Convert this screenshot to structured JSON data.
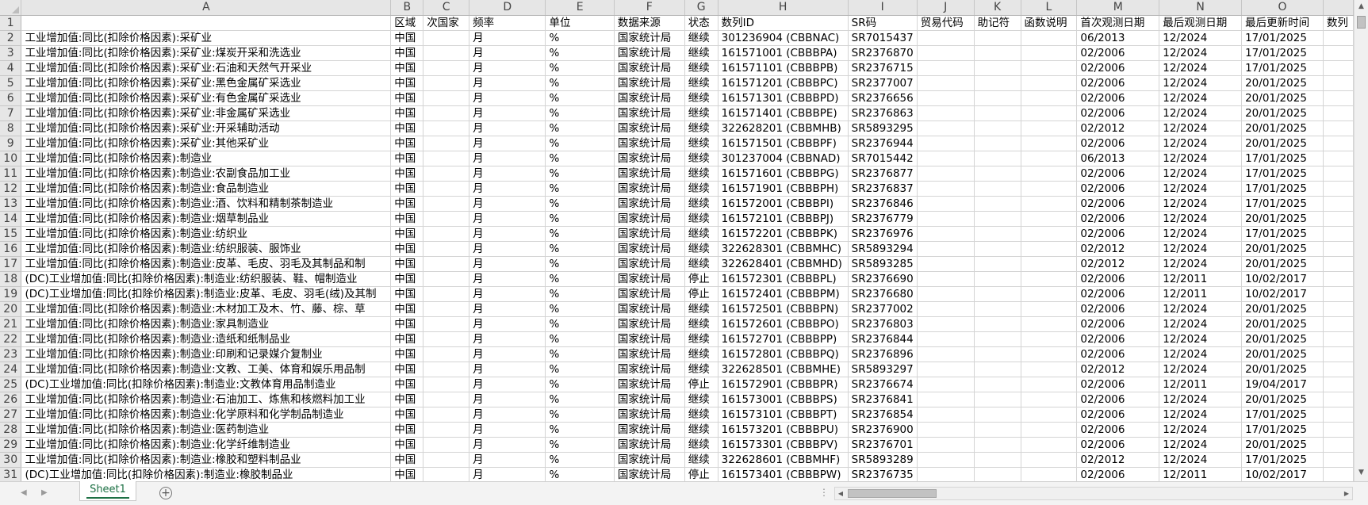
{
  "sheet": {
    "column_letters": [
      "A",
      "B",
      "C",
      "D",
      "E",
      "F",
      "G",
      "H",
      "I",
      "J",
      "K",
      "L",
      "M",
      "N",
      "O",
      ""
    ],
    "header_row": {
      "number": "1",
      "cells": [
        "",
        "区域",
        "次国家",
        "频率",
        "单位",
        "数据来源",
        "状态",
        "数列ID",
        "SR码",
        "贸易代码",
        "助记符",
        "函数说明",
        "首次观测日期",
        "最后观测日期",
        "最后更新时间",
        "数列"
      ]
    },
    "rows": [
      {
        "n": "2",
        "a": "工业增加值:同比(扣除价格因素):采矿业",
        "b": "中国",
        "c": "",
        "d": "月",
        "e": "%",
        "f": "国家统计局",
        "g": "继续",
        "h": "301236904 (CBBNAC)",
        "i": "SR7015437",
        "m": "06/2013",
        "nn": "12/2024",
        "o": "17/01/2025"
      },
      {
        "n": "3",
        "a": "工业增加值:同比(扣除价格因素):采矿业:煤炭开采和洗选业",
        "b": "中国",
        "c": "",
        "d": "月",
        "e": "%",
        "f": "国家统计局",
        "g": "继续",
        "h": "161571001 (CBBBPA)",
        "i": "SR2376870",
        "m": "02/2006",
        "nn": "12/2024",
        "o": "17/01/2025"
      },
      {
        "n": "4",
        "a": "工业增加值:同比(扣除价格因素):采矿业:石油和天然气开采业",
        "b": "中国",
        "c": "",
        "d": "月",
        "e": "%",
        "f": "国家统计局",
        "g": "继续",
        "h": "161571101 (CBBBPB)",
        "i": "SR2376715",
        "m": "02/2006",
        "nn": "12/2024",
        "o": "17/01/2025"
      },
      {
        "n": "5",
        "a": "工业增加值:同比(扣除价格因素):采矿业:黑色金属矿采选业",
        "b": "中国",
        "c": "",
        "d": "月",
        "e": "%",
        "f": "国家统计局",
        "g": "继续",
        "h": "161571201 (CBBBPC)",
        "i": "SR2377007",
        "m": "02/2006",
        "nn": "12/2024",
        "o": "20/01/2025"
      },
      {
        "n": "6",
        "a": "工业增加值:同比(扣除价格因素):采矿业:有色金属矿采选业",
        "b": "中国",
        "c": "",
        "d": "月",
        "e": "%",
        "f": "国家统计局",
        "g": "继续",
        "h": "161571301 (CBBBPD)",
        "i": "SR2376656",
        "m": "02/2006",
        "nn": "12/2024",
        "o": "20/01/2025"
      },
      {
        "n": "7",
        "a": "工业增加值:同比(扣除价格因素):采矿业:非金属矿采选业",
        "b": "中国",
        "c": "",
        "d": "月",
        "e": "%",
        "f": "国家统计局",
        "g": "继续",
        "h": "161571401 (CBBBPE)",
        "i": "SR2376863",
        "m": "02/2006",
        "nn": "12/2024",
        "o": "20/01/2025"
      },
      {
        "n": "8",
        "a": "工业增加值:同比(扣除价格因素):采矿业:开采辅助活动",
        "b": "中国",
        "c": "",
        "d": "月",
        "e": "%",
        "f": "国家统计局",
        "g": "继续",
        "h": "322628201 (CBBMHB)",
        "i": "SR5893295",
        "m": "02/2012",
        "nn": "12/2024",
        "o": "20/01/2025"
      },
      {
        "n": "9",
        "a": "工业增加值:同比(扣除价格因素):采矿业:其他采矿业",
        "b": "中国",
        "c": "",
        "d": "月",
        "e": "%",
        "f": "国家统计局",
        "g": "继续",
        "h": "161571501 (CBBBPF)",
        "i": "SR2376944",
        "m": "02/2006",
        "nn": "12/2024",
        "o": "20/01/2025"
      },
      {
        "n": "10",
        "a": "工业增加值:同比(扣除价格因素):制造业",
        "b": "中国",
        "c": "",
        "d": "月",
        "e": "%",
        "f": "国家统计局",
        "g": "继续",
        "h": "301237004 (CBBNAD)",
        "i": "SR7015442",
        "m": "06/2013",
        "nn": "12/2024",
        "o": "17/01/2025"
      },
      {
        "n": "11",
        "a": "工业增加值:同比(扣除价格因素):制造业:农副食品加工业",
        "b": "中国",
        "c": "",
        "d": "月",
        "e": "%",
        "f": "国家统计局",
        "g": "继续",
        "h": "161571601 (CBBBPG)",
        "i": "SR2376877",
        "m": "02/2006",
        "nn": "12/2024",
        "o": "17/01/2025"
      },
      {
        "n": "12",
        "a": "工业增加值:同比(扣除价格因素):制造业:食品制造业",
        "b": "中国",
        "c": "",
        "d": "月",
        "e": "%",
        "f": "国家统计局",
        "g": "继续",
        "h": "161571901 (CBBBPH)",
        "i": "SR2376837",
        "m": "02/2006",
        "nn": "12/2024",
        "o": "17/01/2025"
      },
      {
        "n": "13",
        "a": "工业增加值:同比(扣除价格因素):制造业:酒、饮料和精制茶制造业",
        "b": "中国",
        "c": "",
        "d": "月",
        "e": "%",
        "f": "国家统计局",
        "g": "继续",
        "h": "161572001 (CBBBPI)",
        "i": "SR2376846",
        "m": "02/2006",
        "nn": "12/2024",
        "o": "17/01/2025"
      },
      {
        "n": "14",
        "a": "工业增加值:同比(扣除价格因素):制造业:烟草制品业",
        "b": "中国",
        "c": "",
        "d": "月",
        "e": "%",
        "f": "国家统计局",
        "g": "继续",
        "h": "161572101 (CBBBPJ)",
        "i": "SR2376779",
        "m": "02/2006",
        "nn": "12/2024",
        "o": "20/01/2025"
      },
      {
        "n": "15",
        "a": "工业增加值:同比(扣除价格因素):制造业:纺织业",
        "b": "中国",
        "c": "",
        "d": "月",
        "e": "%",
        "f": "国家统计局",
        "g": "继续",
        "h": "161572201 (CBBBPK)",
        "i": "SR2376976",
        "m": "02/2006",
        "nn": "12/2024",
        "o": "17/01/2025"
      },
      {
        "n": "16",
        "a": "工业增加值:同比(扣除价格因素):制造业:纺织服装、服饰业",
        "b": "中国",
        "c": "",
        "d": "月",
        "e": "%",
        "f": "国家统计局",
        "g": "继续",
        "h": "322628301 (CBBMHC)",
        "i": "SR5893294",
        "m": "02/2012",
        "nn": "12/2024",
        "o": "20/01/2025"
      },
      {
        "n": "17",
        "a": "工业增加值:同比(扣除价格因素):制造业:皮革、毛皮、羽毛及其制品和制",
        "b": "中国",
        "c": "",
        "d": "月",
        "e": "%",
        "f": "国家统计局",
        "g": "继续",
        "h": "322628401 (CBBMHD)",
        "i": "SR5893285",
        "m": "02/2012",
        "nn": "12/2024",
        "o": "20/01/2025"
      },
      {
        "n": "18",
        "a": "(DC)工业增加值:同比(扣除价格因素):制造业:纺织服装、鞋、帽制造业",
        "b": "中国",
        "c": "",
        "d": "月",
        "e": "%",
        "f": "国家统计局",
        "g": "停止",
        "h": "161572301 (CBBBPL)",
        "i": "SR2376690",
        "m": "02/2006",
        "nn": "12/2011",
        "o": "10/02/2017"
      },
      {
        "n": "19",
        "a": "(DC)工业增加值:同比(扣除价格因素):制造业:皮革、毛皮、羽毛(绒)及其制",
        "b": "中国",
        "c": "",
        "d": "月",
        "e": "%",
        "f": "国家统计局",
        "g": "停止",
        "h": "161572401 (CBBBPM)",
        "i": "SR2376680",
        "m": "02/2006",
        "nn": "12/2011",
        "o": "10/02/2017"
      },
      {
        "n": "20",
        "a": "工业增加值:同比(扣除价格因素):制造业:木材加工及木、竹、藤、棕、草",
        "b": "中国",
        "c": "",
        "d": "月",
        "e": "%",
        "f": "国家统计局",
        "g": "继续",
        "h": "161572501 (CBBBPN)",
        "i": "SR2377002",
        "m": "02/2006",
        "nn": "12/2024",
        "o": "20/01/2025"
      },
      {
        "n": "21",
        "a": "工业增加值:同比(扣除价格因素):制造业:家具制造业",
        "b": "中国",
        "c": "",
        "d": "月",
        "e": "%",
        "f": "国家统计局",
        "g": "继续",
        "h": "161572601 (CBBBPO)",
        "i": "SR2376803",
        "m": "02/2006",
        "nn": "12/2024",
        "o": "20/01/2025"
      },
      {
        "n": "22",
        "a": "工业增加值:同比(扣除价格因素):制造业:造纸和纸制品业",
        "b": "中国",
        "c": "",
        "d": "月",
        "e": "%",
        "f": "国家统计局",
        "g": "继续",
        "h": "161572701 (CBBBPP)",
        "i": "SR2376844",
        "m": "02/2006",
        "nn": "12/2024",
        "o": "20/01/2025"
      },
      {
        "n": "23",
        "a": "工业增加值:同比(扣除价格因素):制造业:印刷和记录媒介复制业",
        "b": "中国",
        "c": "",
        "d": "月",
        "e": "%",
        "f": "国家统计局",
        "g": "继续",
        "h": "161572801 (CBBBPQ)",
        "i": "SR2376896",
        "m": "02/2006",
        "nn": "12/2024",
        "o": "20/01/2025"
      },
      {
        "n": "24",
        "a": "工业增加值:同比(扣除价格因素):制造业:文教、工美、体育和娱乐用品制",
        "b": "中国",
        "c": "",
        "d": "月",
        "e": "%",
        "f": "国家统计局",
        "g": "继续",
        "h": "322628501 (CBBMHE)",
        "i": "SR5893297",
        "m": "02/2012",
        "nn": "12/2024",
        "o": "20/01/2025"
      },
      {
        "n": "25",
        "a": "(DC)工业增加值:同比(扣除价格因素):制造业:文教体育用品制造业",
        "b": "中国",
        "c": "",
        "d": "月",
        "e": "%",
        "f": "国家统计局",
        "g": "停止",
        "h": "161572901 (CBBBPR)",
        "i": "SR2376674",
        "m": "02/2006",
        "nn": "12/2011",
        "o": "19/04/2017"
      },
      {
        "n": "26",
        "a": "工业增加值:同比(扣除价格因素):制造业:石油加工、炼焦和核燃料加工业",
        "b": "中国",
        "c": "",
        "d": "月",
        "e": "%",
        "f": "国家统计局",
        "g": "继续",
        "h": "161573001 (CBBBPS)",
        "i": "SR2376841",
        "m": "02/2006",
        "nn": "12/2024",
        "o": "20/01/2025"
      },
      {
        "n": "27",
        "a": "工业增加值:同比(扣除价格因素):制造业:化学原料和化学制品制造业",
        "b": "中国",
        "c": "",
        "d": "月",
        "e": "%",
        "f": "国家统计局",
        "g": "继续",
        "h": "161573101 (CBBBPT)",
        "i": "SR2376854",
        "m": "02/2006",
        "nn": "12/2024",
        "o": "17/01/2025"
      },
      {
        "n": "28",
        "a": "工业增加值:同比(扣除价格因素):制造业:医药制造业",
        "b": "中国",
        "c": "",
        "d": "月",
        "e": "%",
        "f": "国家统计局",
        "g": "继续",
        "h": "161573201 (CBBBPU)",
        "i": "SR2376900",
        "m": "02/2006",
        "nn": "12/2024",
        "o": "17/01/2025"
      },
      {
        "n": "29",
        "a": "工业增加值:同比(扣除价格因素):制造业:化学纤维制造业",
        "b": "中国",
        "c": "",
        "d": "月",
        "e": "%",
        "f": "国家统计局",
        "g": "继续",
        "h": "161573301 (CBBBPV)",
        "i": "SR2376701",
        "m": "02/2006",
        "nn": "12/2024",
        "o": "20/01/2025"
      },
      {
        "n": "30",
        "a": "工业增加值:同比(扣除价格因素):制造业:橡胶和塑料制品业",
        "b": "中国",
        "c": "",
        "d": "月",
        "e": "%",
        "f": "国家统计局",
        "g": "继续",
        "h": "322628601 (CBBMHF)",
        "i": "SR5893289",
        "m": "02/2012",
        "nn": "12/2024",
        "o": "17/01/2025"
      },
      {
        "n": "31",
        "a": "(DC)工业增加值:同比(扣除价格因素):制造业:橡胶制品业",
        "b": "中国",
        "c": "",
        "d": "月",
        "e": "%",
        "f": "国家统计局",
        "g": "停止",
        "h": "161573401 (CBBBPW)",
        "i": "SR2376735",
        "m": "02/2006",
        "nn": "12/2011",
        "o": "10/02/2017"
      }
    ]
  },
  "tabs": {
    "active_sheet": "Sheet1"
  },
  "icons": {
    "scroll_up": "triangle-up",
    "scroll_down": "triangle-down",
    "scroll_left": "triangle-left",
    "scroll_right": "triangle-right",
    "add_sheet": "plus-circle",
    "more": "vertical-dots"
  },
  "colors": {
    "tab_accent": "#1e7145",
    "header_bg": "#e6e6e6",
    "grid_line": "#d4d4d4"
  }
}
